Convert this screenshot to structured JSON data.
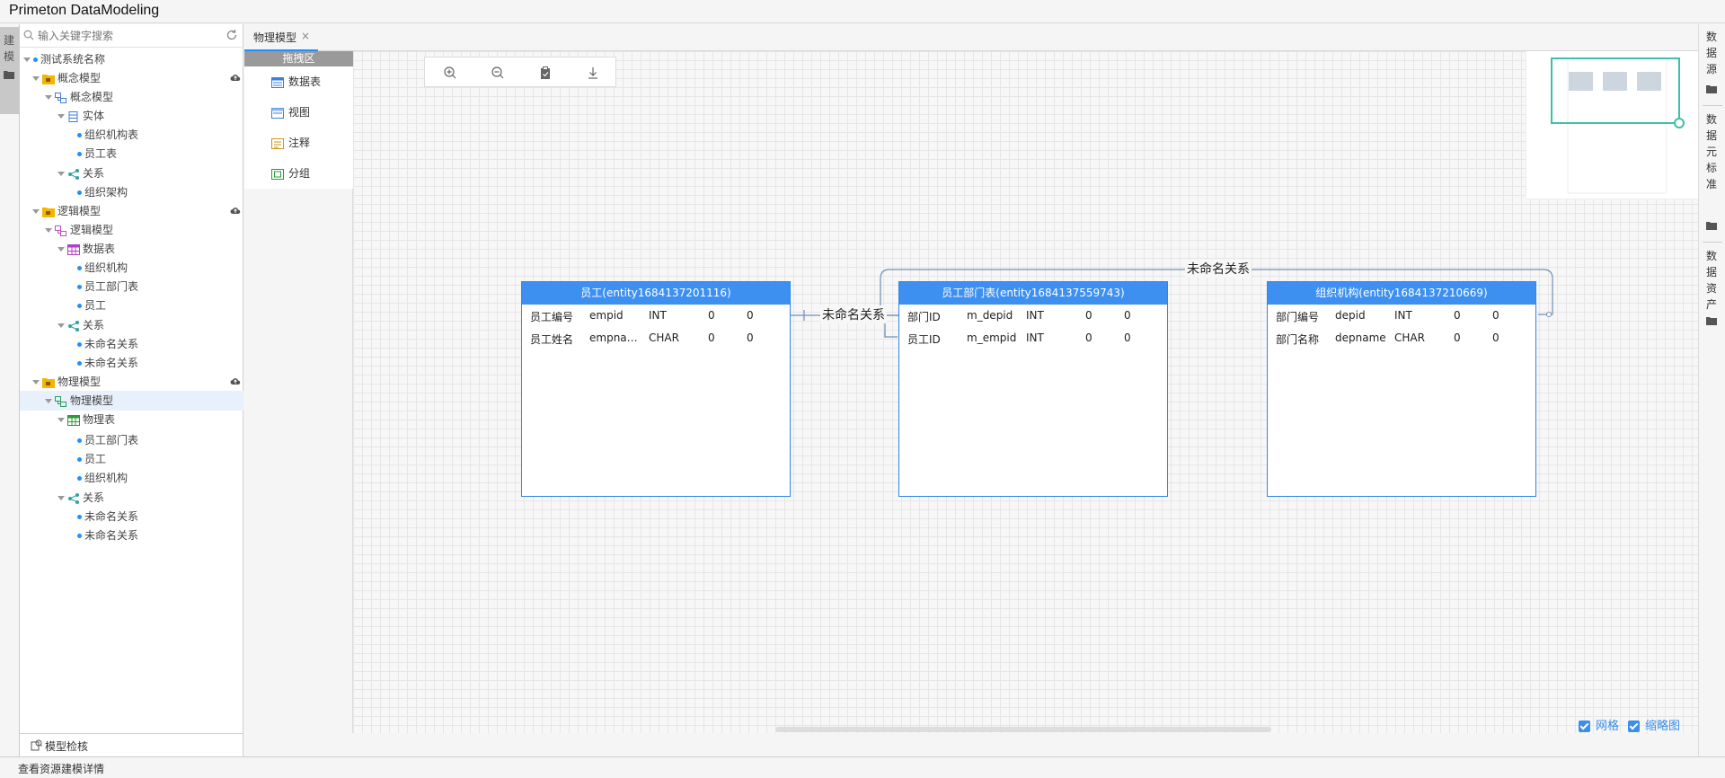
{
  "app": {
    "title": "Primeton DataModeling"
  },
  "left_strip": {
    "tab_label": "建模"
  },
  "search": {
    "placeholder": "输入关键字搜索"
  },
  "tree": {
    "root": "测试系统名称",
    "conceptual_group": "概念模型",
    "conceptual_model": "概念模型",
    "entity_folder": "实体",
    "entity_items": [
      "组织机构表",
      "员工表"
    ],
    "relation_folder_1": "关系",
    "relation_items_1": [
      "组织架构"
    ],
    "logical_group": "逻辑模型",
    "logical_model": "逻辑模型",
    "datatable_folder": "数据表",
    "datatable_items": [
      "组织机构",
      "员工部门表",
      "员工"
    ],
    "relation_folder_2": "关系",
    "relation_items_2": [
      "未命名关系",
      "未命名关系"
    ],
    "physical_group": "物理模型",
    "physical_model": "物理模型",
    "physical_table_folder": "物理表",
    "physical_table_items": [
      "员工部门表",
      "员工",
      "组织机构"
    ],
    "relation_folder_3": "关系",
    "relation_items_3": [
      "未命名关系",
      "未命名关系"
    ]
  },
  "tree_footer": {
    "label": "模型检核"
  },
  "status_bar": {
    "text": "查看资源建模详情"
  },
  "editor_tab": {
    "label": "物理模型",
    "close": "×"
  },
  "palette": {
    "header": "拖拽区",
    "items": [
      "数据表",
      "视图",
      "注释",
      "分组"
    ]
  },
  "entities": [
    {
      "title": "员工(entity1684137201116)",
      "rows": [
        [
          "员工编号",
          "empid",
          "INT",
          "0",
          "0"
        ],
        [
          "员工姓名",
          "empna…",
          "CHAR",
          "0",
          "0"
        ]
      ]
    },
    {
      "title": "员工部门表(entity1684137559743)",
      "rows": [
        [
          "部门ID",
          "m_depid",
          "INT",
          "0",
          "0"
        ],
        [
          "员工ID",
          "m_empid",
          "INT",
          "0",
          "0"
        ]
      ]
    },
    {
      "title": "组织机构(entity1684137210669)",
      "rows": [
        [
          "部门编号",
          "depid",
          "INT",
          "0",
          "0"
        ],
        [
          "部门名称",
          "depname",
          "CHAR",
          "0",
          "0"
        ]
      ]
    }
  ],
  "relations": {
    "label_1": "未命名关系",
    "label_2": "未命名关系"
  },
  "right_strip": {
    "tab_1": "数据源",
    "tab_2": "数据元标准",
    "tab_3": "数据资产"
  },
  "canvas_options": {
    "grid": "网格",
    "thumbnail": "缩略图"
  },
  "colors": {
    "accent": "#3d8ff0",
    "minimap_frame": "#3cc0a8"
  }
}
